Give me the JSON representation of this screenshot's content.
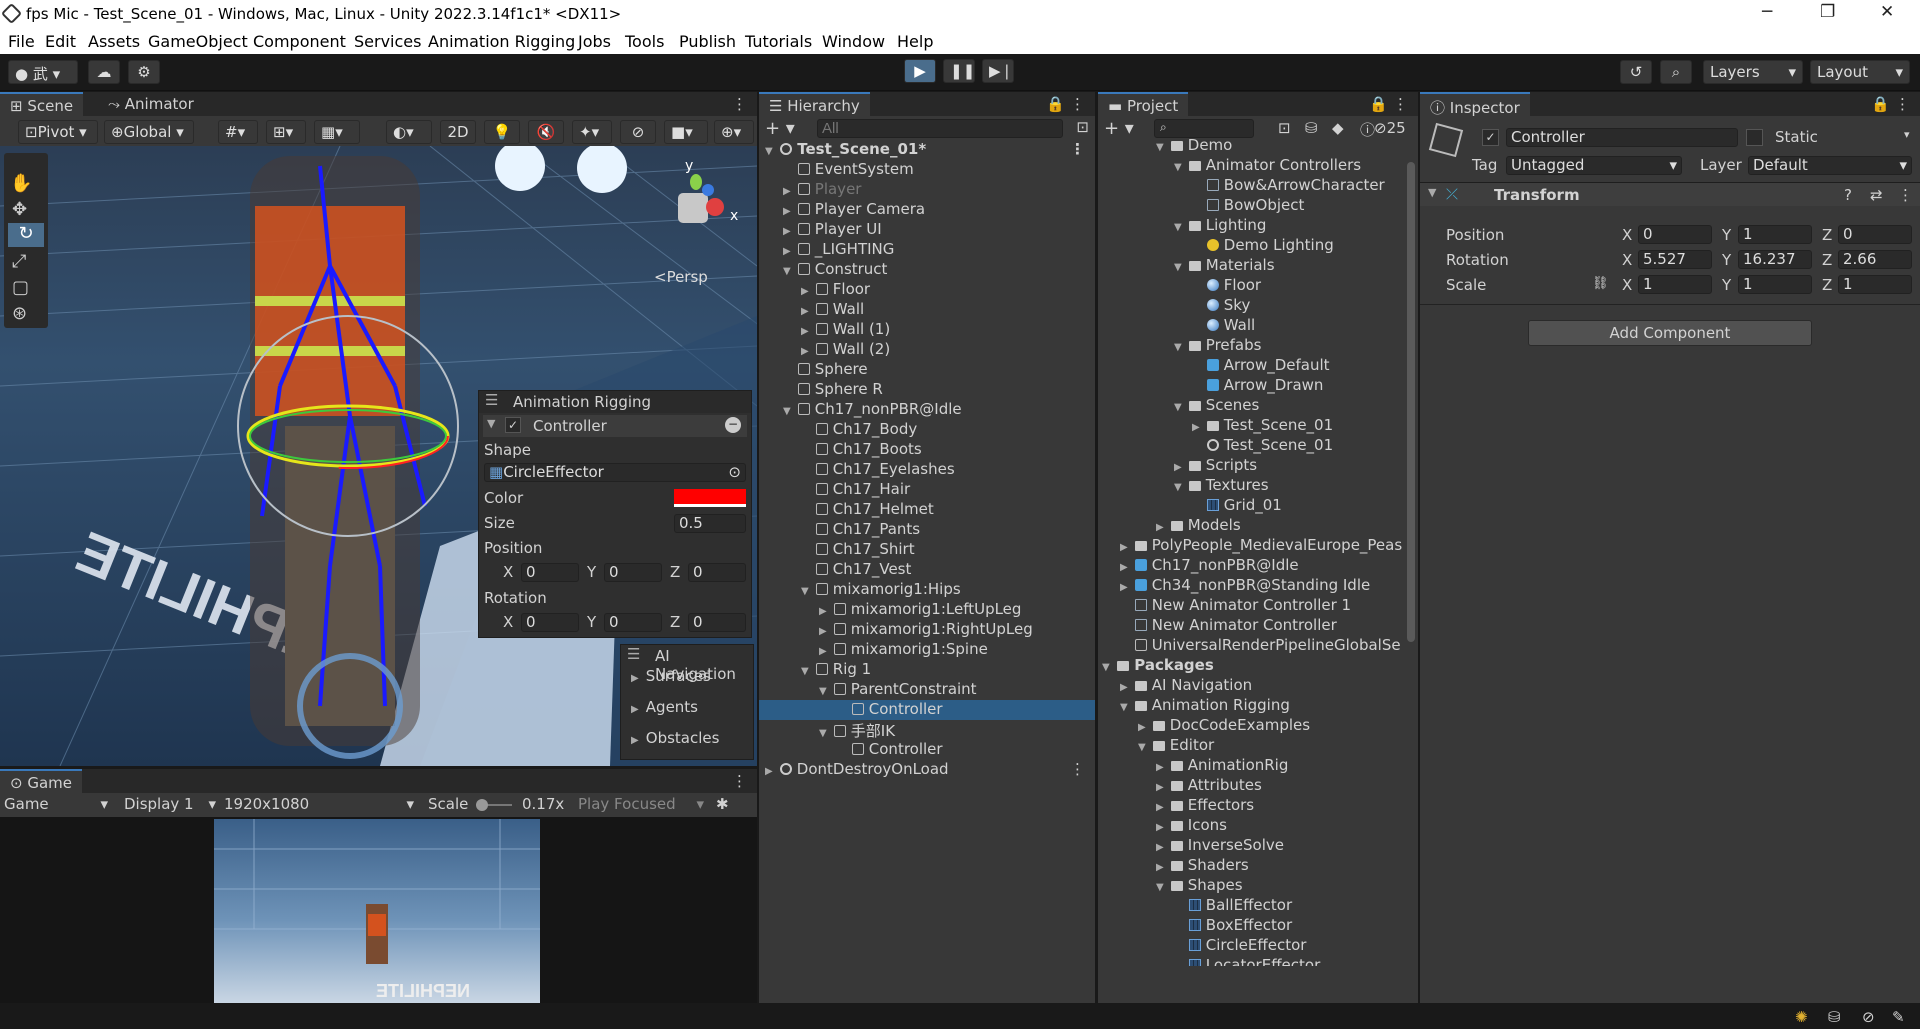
{
  "window": {
    "title": "fps Mic - Test_Scene_01 - Windows, Mac, Linux - Unity 2022.3.14f1c1* <DX11>",
    "minimize": "─",
    "maximize": "❐",
    "close": "✕"
  },
  "menu": [
    "File",
    "Edit",
    "Assets",
    "GameObject",
    "Component",
    "Services",
    "Animation Rigging",
    "Jobs",
    "Tools",
    "Publish",
    "Tutorials",
    "Window",
    "Help"
  ],
  "toolbar": {
    "account": "武",
    "layers": "Layers",
    "layout": "Layout"
  },
  "scene_panel": {
    "tabs": [
      "Scene",
      "Animator"
    ],
    "pivot": "Pivot",
    "global": "Global",
    "mode_2d": "2D",
    "persp": "<Persp",
    "gizmo_x": "x",
    "gizmo_y": "y",
    "floor_text": "NEPHILITE"
  },
  "overlay_rig": {
    "title": "Animation Rigging",
    "controller": "Controller",
    "shape_label": "Shape",
    "shape_value": "CircleEffector",
    "color_label": "Color",
    "color_value": "#ff0000",
    "size_label": "Size",
    "size_value": "0.5",
    "position_label": "Position",
    "rotation_label": "Rotation",
    "pos": {
      "x": "0",
      "y": "0",
      "z": "0"
    },
    "rot": {
      "x": "0",
      "y": "0",
      "z": "0"
    },
    "axis_x": "X",
    "axis_y": "Y",
    "axis_z": "Z"
  },
  "overlay_nav": {
    "title": "AI Navigation",
    "items": [
      "Surfaces",
      "Agents",
      "Obstacles"
    ]
  },
  "game_panel": {
    "tab": "Game",
    "mode": "Game",
    "display": "Display 1",
    "resolution": "1920x1080",
    "scale_label": "Scale",
    "scale_value": "0.17x",
    "play_focused": "Play Focused"
  },
  "hierarchy": {
    "tab": "Hierarchy",
    "search_placeholder": "All",
    "rows": [
      {
        "label": "Test_Scene_01*",
        "indent": 0,
        "arrow": "▼",
        "icon": "scene",
        "bold": true
      },
      {
        "label": "EventSystem",
        "indent": 1,
        "arrow": "",
        "icon": "go"
      },
      {
        "label": "Player",
        "indent": 1,
        "arrow": "▶",
        "icon": "go",
        "dim": true
      },
      {
        "label": "Player Camera",
        "indent": 1,
        "arrow": "▶",
        "icon": "go"
      },
      {
        "label": "Player UI",
        "indent": 1,
        "arrow": "▶",
        "icon": "go"
      },
      {
        "label": "_LIGHTING",
        "indent": 1,
        "arrow": "▶",
        "icon": "go"
      },
      {
        "label": "Construct",
        "indent": 1,
        "arrow": "▼",
        "icon": "go"
      },
      {
        "label": "Floor",
        "indent": 2,
        "arrow": "▶",
        "icon": "go"
      },
      {
        "label": "Wall",
        "indent": 2,
        "arrow": "▶",
        "icon": "go"
      },
      {
        "label": "Wall (1)",
        "indent": 2,
        "arrow": "▶",
        "icon": "go"
      },
      {
        "label": "Wall (2)",
        "indent": 2,
        "arrow": "▶",
        "icon": "go"
      },
      {
        "label": "Sphere",
        "indent": 1,
        "arrow": "",
        "icon": "go"
      },
      {
        "label": "Sphere R",
        "indent": 1,
        "arrow": "",
        "icon": "go"
      },
      {
        "label": "Ch17_nonPBR@Idle",
        "indent": 1,
        "arrow": "▼",
        "icon": "go"
      },
      {
        "label": "Ch17_Body",
        "indent": 2,
        "arrow": "",
        "icon": "go"
      },
      {
        "label": "Ch17_Boots",
        "indent": 2,
        "arrow": "",
        "icon": "go"
      },
      {
        "label": "Ch17_Eyelashes",
        "indent": 2,
        "arrow": "",
        "icon": "go"
      },
      {
        "label": "Ch17_Hair",
        "indent": 2,
        "arrow": "",
        "icon": "go"
      },
      {
        "label": "Ch17_Helmet",
        "indent": 2,
        "arrow": "",
        "icon": "go"
      },
      {
        "label": "Ch17_Pants",
        "indent": 2,
        "arrow": "",
        "icon": "go"
      },
      {
        "label": "Ch17_Shirt",
        "indent": 2,
        "arrow": "",
        "icon": "go"
      },
      {
        "label": "Ch17_Vest",
        "indent": 2,
        "arrow": "",
        "icon": "go"
      },
      {
        "label": "mixamorig1:Hips",
        "indent": 2,
        "arrow": "▼",
        "icon": "go"
      },
      {
        "label": "mixamorig1:LeftUpLeg",
        "indent": 3,
        "arrow": "▶",
        "icon": "go"
      },
      {
        "label": "mixamorig1:RightUpLeg",
        "indent": 3,
        "arrow": "▶",
        "icon": "go"
      },
      {
        "label": "mixamorig1:Spine",
        "indent": 3,
        "arrow": "▶",
        "icon": "go"
      },
      {
        "label": "Rig 1",
        "indent": 2,
        "arrow": "▼",
        "icon": "go"
      },
      {
        "label": "ParentConstraint",
        "indent": 3,
        "arrow": "▼",
        "icon": "go"
      },
      {
        "label": "Controller",
        "indent": 4,
        "arrow": "",
        "icon": "go",
        "selected": true
      },
      {
        "label": "手部IK",
        "indent": 3,
        "arrow": "▼",
        "icon": "go"
      },
      {
        "label": "Controller",
        "indent": 4,
        "arrow": "",
        "icon": "go"
      },
      {
        "label": "DontDestroyOnLoad",
        "indent": 0,
        "arrow": "▶",
        "icon": "scene"
      }
    ]
  },
  "project": {
    "tab": "Project",
    "hidden_count": "25",
    "rows": [
      {
        "label": "Demo",
        "indent": 3,
        "arrow": "▼",
        "icon": "folder"
      },
      {
        "label": "Animator Controllers",
        "indent": 4,
        "arrow": "▼",
        "icon": "folder"
      },
      {
        "label": "Bow&ArrowCharacter",
        "indent": 5,
        "arrow": "",
        "icon": "anim"
      },
      {
        "label": "BowObject",
        "indent": 5,
        "arrow": "",
        "icon": "anim"
      },
      {
        "label": "Lighting",
        "indent": 4,
        "arrow": "▼",
        "icon": "folder"
      },
      {
        "label": "Demo Lighting",
        "indent": 5,
        "arrow": "",
        "icon": "light"
      },
      {
        "label": "Materials",
        "indent": 4,
        "arrow": "▼",
        "icon": "folder"
      },
      {
        "label": "Floor",
        "indent": 5,
        "arrow": "",
        "icon": "mat"
      },
      {
        "label": "Sky",
        "indent": 5,
        "arrow": "",
        "icon": "mat"
      },
      {
        "label": "Wall",
        "indent": 5,
        "arrow": "",
        "icon": "mat"
      },
      {
        "label": "Prefabs",
        "indent": 4,
        "arrow": "▼",
        "icon": "folder"
      },
      {
        "label": "Arrow_Default",
        "indent": 5,
        "arrow": "",
        "icon": "prefab"
      },
      {
        "label": "Arrow_Drawn",
        "indent": 5,
        "arrow": "",
        "icon": "prefab"
      },
      {
        "label": "Scenes",
        "indent": 4,
        "arrow": "▼",
        "icon": "folder"
      },
      {
        "label": "Test_Scene_01",
        "indent": 5,
        "arrow": "▶",
        "icon": "folder"
      },
      {
        "label": "Test_Scene_01",
        "indent": 5,
        "arrow": "",
        "icon": "scene"
      },
      {
        "label": "Scripts",
        "indent": 4,
        "arrow": "▶",
        "icon": "folder"
      },
      {
        "label": "Textures",
        "indent": 4,
        "arrow": "▼",
        "icon": "folder"
      },
      {
        "label": "Grid_01",
        "indent": 5,
        "arrow": "",
        "icon": "tex"
      },
      {
        "label": "Models",
        "indent": 3,
        "arrow": "▶",
        "icon": "folder"
      },
      {
        "label": "PolyPeople_MedievalEurope_Peas",
        "indent": 1,
        "arrow": "▶",
        "icon": "folder"
      },
      {
        "label": "Ch17_nonPBR@Idle",
        "indent": 1,
        "arrow": "▶",
        "icon": "prefab"
      },
      {
        "label": "Ch34_nonPBR@Standing Idle",
        "indent": 1,
        "arrow": "▶",
        "icon": "prefab"
      },
      {
        "label": "New Animator Controller 1",
        "indent": 1,
        "arrow": "",
        "icon": "anim"
      },
      {
        "label": "New Animator Controller",
        "indent": 1,
        "arrow": "",
        "icon": "anim"
      },
      {
        "label": "UniversalRenderPipelineGlobalSe",
        "indent": 1,
        "arrow": "",
        "icon": "go"
      },
      {
        "label": "Packages",
        "indent": 0,
        "arrow": "▼",
        "icon": "folder",
        "bold": true
      },
      {
        "label": "AI Navigation",
        "indent": 1,
        "arrow": "▶",
        "icon": "folder"
      },
      {
        "label": "Animation Rigging",
        "indent": 1,
        "arrow": "▼",
        "icon": "folder"
      },
      {
        "label": "DocCodeExamples",
        "indent": 2,
        "arrow": "▶",
        "icon": "folder"
      },
      {
        "label": "Editor",
        "indent": 2,
        "arrow": "▼",
        "icon": "folder"
      },
      {
        "label": "AnimationRig",
        "indent": 3,
        "arrow": "▶",
        "icon": "folder"
      },
      {
        "label": "Attributes",
        "indent": 3,
        "arrow": "▶",
        "icon": "folder"
      },
      {
        "label": "Effectors",
        "indent": 3,
        "arrow": "▶",
        "icon": "folder"
      },
      {
        "label": "Icons",
        "indent": 3,
        "arrow": "▶",
        "icon": "folder"
      },
      {
        "label": "InverseSolve",
        "indent": 3,
        "arrow": "▶",
        "icon": "folder"
      },
      {
        "label": "Shaders",
        "indent": 3,
        "arrow": "▶",
        "icon": "folder"
      },
      {
        "label": "Shapes",
        "indent": 3,
        "arrow": "▼",
        "icon": "folder"
      },
      {
        "label": "BallEffector",
        "indent": 4,
        "arrow": "",
        "icon": "tex"
      },
      {
        "label": "BoxEffector",
        "indent": 4,
        "arrow": "",
        "icon": "tex"
      },
      {
        "label": "CircleEffector",
        "indent": 4,
        "arrow": "",
        "icon": "tex"
      },
      {
        "label": "LocatorEffector",
        "indent": 4,
        "arrow": "",
        "icon": "tex"
      }
    ]
  },
  "inspector": {
    "tab": "Inspector",
    "object_name": "Controller",
    "static_label": "Static",
    "tag_label": "Tag",
    "tag_value": "Untagged",
    "layer_label": "Layer",
    "layer_value": "Default",
    "transform_title": "Transform",
    "position_label": "Position",
    "rotation_label": "Rotation",
    "scale_label": "Scale",
    "position": {
      "x": "0",
      "y": "1",
      "z": "0"
    },
    "rotation": {
      "x": "5.527",
      "y": "16.237",
      "z": "2.66"
    },
    "scale": {
      "x": "1",
      "y": "1",
      "z": "1"
    },
    "axis_x": "X",
    "axis_y": "Y",
    "axis_z": "Z",
    "add_component": "Add Component"
  }
}
